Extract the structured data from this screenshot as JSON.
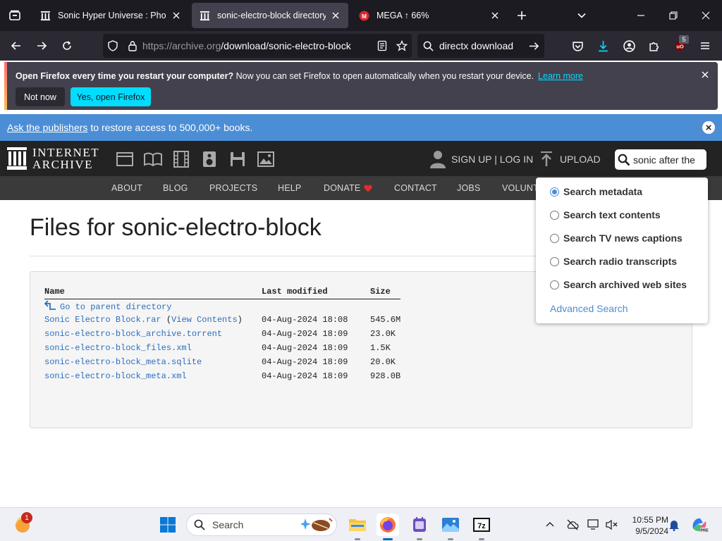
{
  "tabs": [
    {
      "title": "Sonic Hyper Universe : Phoenix",
      "icon": "archive-icon",
      "active": false
    },
    {
      "title": "sonic-electro-block directory li",
      "icon": "archive-icon",
      "active": true
    },
    {
      "title": "MEGA ↑ 66%",
      "icon": "mega-icon",
      "active": false
    }
  ],
  "navbar": {
    "url_host": "https://archive.org",
    "url_path": "/download/sonic-electro-block",
    "search_text": "directx download",
    "extension_badge": "5"
  },
  "notification": {
    "bold_text": "Open Firefox every time you restart your computer?",
    "text": "Now you can set Firefox to open automatically when you restart your device.",
    "link": "Learn more",
    "not_now": "Not now",
    "yes": "Yes, open Firefox"
  },
  "banner": {
    "link": "Ask the publishers",
    "text": "to restore access to 500,000+ books."
  },
  "ia_header": {
    "logo_line1": "INTERNET",
    "logo_line2": "ARCHIVE",
    "signup": "SIGN UP | LOG IN",
    "upload": "UPLOAD",
    "search_value": "sonic after the"
  },
  "ia_nav": [
    "ABOUT",
    "BLOG",
    "PROJECTS",
    "HELP",
    "DONATE",
    "CONTACT",
    "JOBS",
    "VOLUNT"
  ],
  "page": {
    "title": "Files for sonic-electro-block",
    "headers": {
      "name": "Name",
      "modified": "Last modified",
      "size": "Size"
    },
    "parent": "Go to parent directory",
    "files": [
      {
        "name": "Sonic Electro Block.rar",
        "extra": "View Contents",
        "modified": "04-Aug-2024 18:08",
        "size": "545.6M"
      },
      {
        "name": "sonic-electro-block_archive.torrent",
        "extra": "",
        "modified": "04-Aug-2024 18:09",
        "size": "23.0K"
      },
      {
        "name": "sonic-electro-block_files.xml",
        "extra": "",
        "modified": "04-Aug-2024 18:09",
        "size": "1.5K"
      },
      {
        "name": "sonic-electro-block_meta.sqlite",
        "extra": "",
        "modified": "04-Aug-2024 18:09",
        "size": "20.0K"
      },
      {
        "name": "sonic-electro-block_meta.xml",
        "extra": "",
        "modified": "04-Aug-2024 18:09",
        "size": "928.0B"
      }
    ]
  },
  "search_dropdown": {
    "options": [
      {
        "label": "Search metadata",
        "selected": true
      },
      {
        "label": "Search text contents",
        "selected": false
      },
      {
        "label": "Search TV news captions",
        "selected": false
      },
      {
        "label": "Search radio transcripts",
        "selected": false
      },
      {
        "label": "Search archived web sites",
        "selected": false
      }
    ],
    "advanced": "Advanced Search"
  },
  "taskbar": {
    "search_placeholder": "Search",
    "time": "10:55 PM",
    "date": "9/5/2024",
    "weather_badge": "1"
  },
  "colors": {
    "firefox_dark": "#1c1b22",
    "firefox_accent": "#00ddff",
    "ia_blue": "#4c8ed6",
    "link_blue": "#2a6fbf"
  }
}
